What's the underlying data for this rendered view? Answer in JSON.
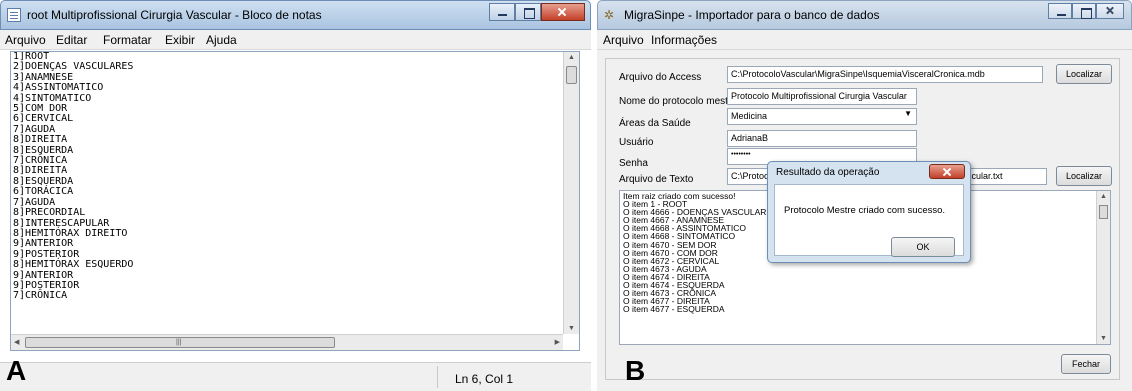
{
  "notepad": {
    "title": "root Multiprofissional Cirurgia Vascular - Bloco de notas",
    "menu": [
      "Arquivo",
      "Editar",
      "Formatar",
      "Exibir",
      "Ajuda"
    ],
    "lines": [
      "1]ROOT",
      "2]DOENÇAS VASCULARES",
      "3]ANAMNESE",
      "4]ASSINTOMATICO",
      "4]SINTOMATICO",
      "5]COM DOR",
      "6]CERVICAL",
      "7]AGUDA",
      "8]DIREITA",
      "8]ESQUERDA",
      "7]CRÔNICA",
      "8]DIREITA",
      "8]ESQUERDA",
      "6]TORÁCICA",
      "7]AGUDA",
      "8]PRECORDIAL",
      "8]INTERESCAPULAR",
      "8]HEMITÓRAX DIREITO",
      "9]ANTERIOR",
      "9]POSTERIOR",
      "8]HEMITÓRAX ESQUERDO",
      "9]ANTERIOR",
      "9]POSTERIOR",
      "7]CRÔNICA"
    ],
    "status_position": "Ln 6, Col 1",
    "panel_letter": "A"
  },
  "migrasinpe": {
    "title": "MigraSinpe - Importador para o banco de dados",
    "menu": [
      "Arquivo",
      "Informações"
    ],
    "fields": {
      "access_label": "Arquivo do Access",
      "access_value": "C:\\ProtocoloVascular\\MigraSinpe\\IsquemiaVisceralCronica.mdb",
      "protocol_label": "Nome do protocolo mestre",
      "protocol_value": "Protocolo Multiprofissional Cirurgia Vascular",
      "areas_label": "Áreas da Saúde",
      "areas_value": "Medicina",
      "user_label": "Usuário",
      "user_value": "AdrianaB",
      "password_label": "Senha",
      "password_value": "••••••••",
      "textfile_label": "Arquivo de Texto",
      "textfile_value_left": "C:\\Protoc",
      "textfile_value_right": "ascular.txt"
    },
    "locate_label": "Localizar",
    "close_label": "Fechar",
    "log": [
      "Item raiz criado com sucesso!",
      "O item 1 - ROOT",
      "O item 4666 - DOENÇAS VASCULARES",
      "O item 4667 - ANAMNESE",
      "O item 4668 - ASSINTOMATICO",
      "O item 4668 - SINTOMATICO",
      "O item 4670 - SEM DOR",
      "O item 4670 - COM DOR",
      "O item 4672 - CERVICAL",
      "O item 4673 - AGUDA",
      "O item 4674 - DIREITA",
      "O item 4674 - ESQUERDA",
      "O item 4673 - CRÔNICA",
      "O item 4677 - DIREITA",
      "O item 4677 - ESQUERDA"
    ],
    "dialog": {
      "title": "Resultado da operação",
      "message": "Protocolo Mestre criado com sucesso.",
      "ok_label": "OK"
    },
    "panel_letter": "B"
  }
}
